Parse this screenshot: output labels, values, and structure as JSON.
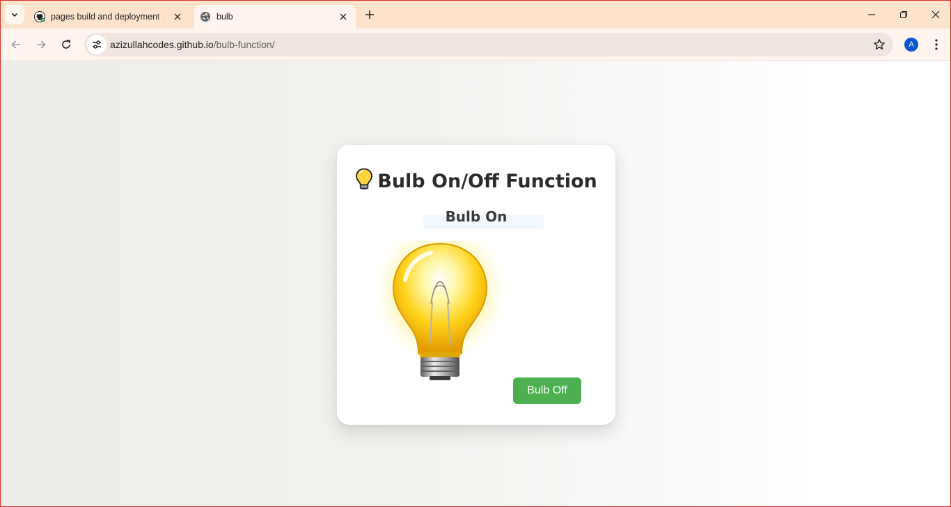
{
  "browser": {
    "tabs": [
      {
        "title": "pages build and deployment · Azizullahcodes/bulb-function",
        "favicon": "github-icon",
        "active": false
      },
      {
        "title": "bulb",
        "favicon": "globe-icon",
        "active": true
      }
    ],
    "address": {
      "host": "azizullahcodes.github.io",
      "path": "/bulb-function/"
    },
    "profile_initial": "A",
    "accent_color": "#fde3cc"
  },
  "page": {
    "heading": "Bulb On/Off Function",
    "heading_icon": "light-bulb-emoji",
    "status": "Bulb On",
    "bulb_state": "on",
    "toggle_label": "Bulb Off",
    "button_color": "#4caf50"
  }
}
